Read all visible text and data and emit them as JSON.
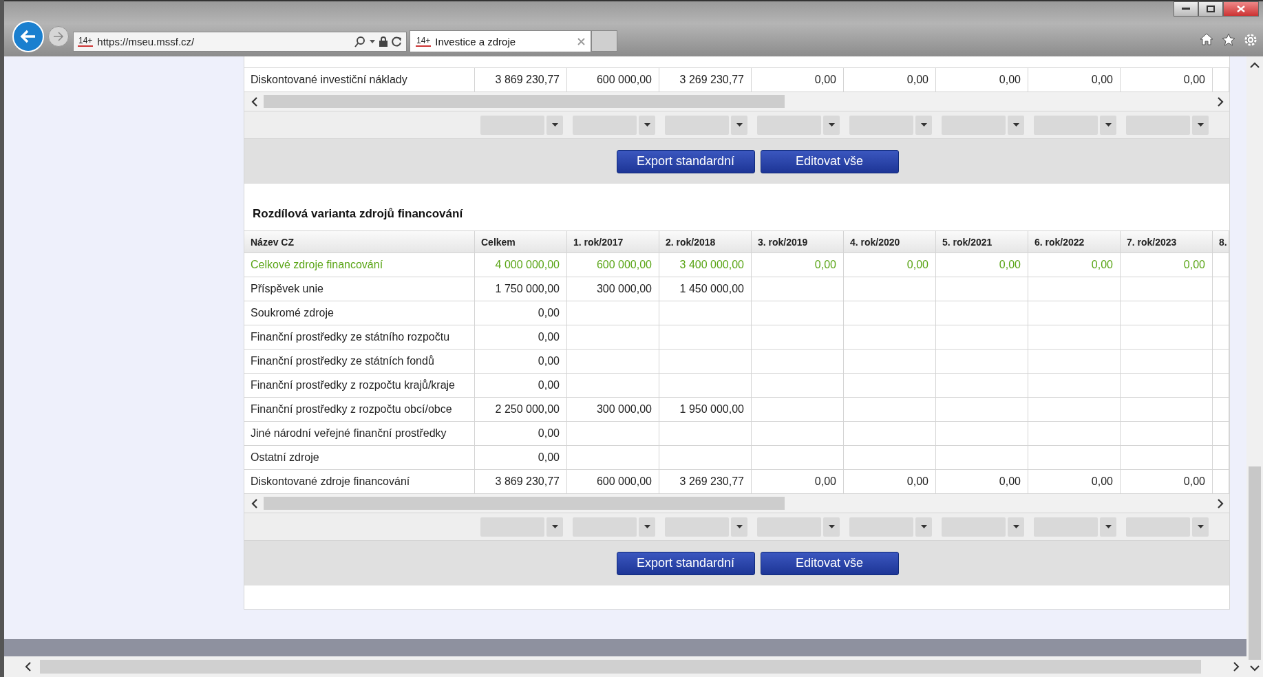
{
  "browser": {
    "address_icon_text": "14+",
    "url": "https://mseu.mssf.cz/",
    "tab_icon_text": "14+",
    "tab_title": "Investice a zdroje"
  },
  "top_table": {
    "rows": [
      {
        "label": "Diskontované investiční náklady",
        "emphasis": false,
        "values": [
          "3 869 230,77",
          "600 000,00",
          "3 269 230,77",
          "0,00",
          "0,00",
          "0,00",
          "0,00",
          "0,00"
        ]
      }
    ],
    "buttons": [
      "Export standardní",
      "Editovat vše"
    ]
  },
  "sources_table": {
    "title": "Rozdílová varianta zdrojů financování",
    "columns": [
      "Název CZ",
      "Celkem",
      "1. rok/2017",
      "2. rok/2018",
      "3. rok/2019",
      "4. rok/2020",
      "5. rok/2021",
      "6. rok/2022",
      "7. rok/2023",
      "8."
    ],
    "rows": [
      {
        "label": "Celkové zdroje financování",
        "emphasis": true,
        "values": [
          "4 000 000,00",
          "600 000,00",
          "3 400 000,00",
          "0,00",
          "0,00",
          "0,00",
          "0,00",
          "0,00"
        ]
      },
      {
        "label": "Příspěvek unie",
        "emphasis": false,
        "values": [
          "1 750 000,00",
          "300 000,00",
          "1 450 000,00"
        ]
      },
      {
        "label": "Soukromé zdroje",
        "emphasis": false,
        "values": [
          "0,00"
        ]
      },
      {
        "label": "Finanční prostředky ze státního rozpočtu",
        "emphasis": false,
        "values": [
          "0,00"
        ]
      },
      {
        "label": "Finanční prostředky ze státních fondů",
        "emphasis": false,
        "values": [
          "0,00"
        ]
      },
      {
        "label": "Finanční prostředky z rozpočtu krajů/kraje",
        "emphasis": false,
        "values": [
          "0,00"
        ]
      },
      {
        "label": "Finanční prostředky z rozpočtu obcí/obce",
        "emphasis": false,
        "values": [
          "2 250 000,00",
          "300 000,00",
          "1 950 000,00"
        ]
      },
      {
        "label": "Jiné národní veřejné finanční prostředky",
        "emphasis": false,
        "values": [
          "0,00"
        ]
      },
      {
        "label": "Ostatní zdroje",
        "emphasis": false,
        "values": [
          "0,00"
        ]
      },
      {
        "label": "Diskontované zdroje financování",
        "emphasis": false,
        "values": [
          "3 869 230,77",
          "600 000,00",
          "3 269 230,77",
          "0,00",
          "0,00",
          "0,00",
          "0,00",
          "0,00"
        ]
      }
    ],
    "buttons": [
      "Export standardní",
      "Editovat vše"
    ]
  }
}
